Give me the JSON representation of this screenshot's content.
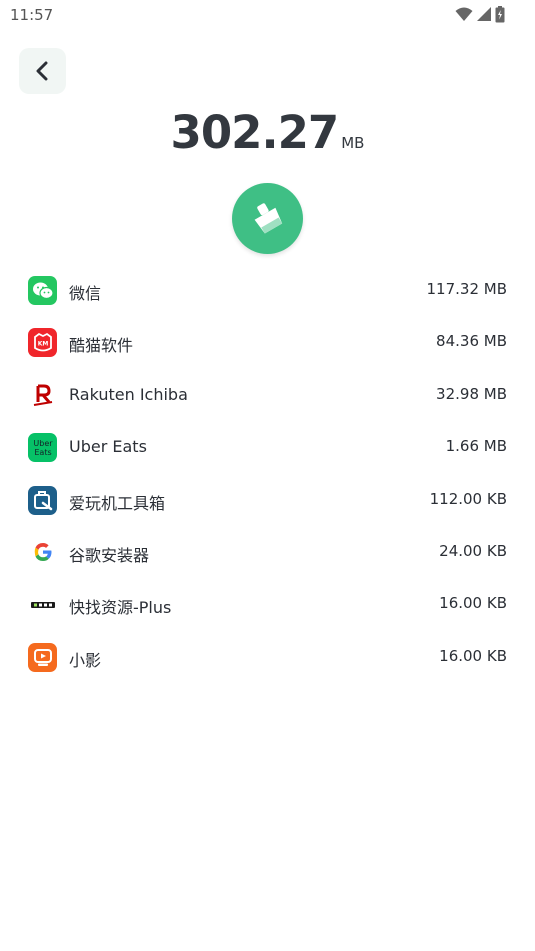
{
  "status_bar": {
    "time": "11:57",
    "icons": [
      "wifi-icon",
      "cell-signal-icon",
      "battery-icon"
    ]
  },
  "header": {
    "back_icon": "chevron-left-icon"
  },
  "summary": {
    "total_value": "302.27",
    "total_unit": "MB",
    "clean_icon": "broom-icon",
    "accent_color": "#3fbf85"
  },
  "apps": [
    {
      "name": "微信",
      "size": "117.32 MB",
      "icon": "wechat-icon"
    },
    {
      "name": "酷猫软件",
      "size": "84.36 MB",
      "icon": "kumao-icon"
    },
    {
      "name": "Rakuten Ichiba",
      "size": "32.98 MB",
      "icon": "rakuten-icon"
    },
    {
      "name": "Uber Eats",
      "size": "1.66 MB",
      "icon": "uber-eats-icon"
    },
    {
      "name": "爱玩机工具箱",
      "size": "112.00 KB",
      "icon": "toolbox-icon"
    },
    {
      "name": "谷歌安装器",
      "size": "24.00 KB",
      "icon": "google-icon"
    },
    {
      "name": "快找资源-Plus",
      "size": "16.00 KB",
      "icon": "kuaizhao-icon"
    },
    {
      "name": "小影",
      "size": "16.00 KB",
      "icon": "xiaoying-icon"
    }
  ]
}
